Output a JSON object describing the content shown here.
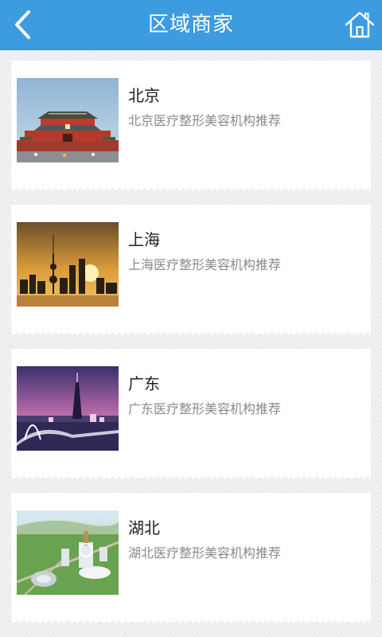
{
  "header": {
    "title": "区域商家",
    "back_icon": "chevron-left-icon",
    "home_icon": "home-icon",
    "bg_color": "#3d9be0"
  },
  "regions": [
    {
      "name": "北京",
      "description": "北京医疗整形美容机构推荐",
      "image": "tiananmen-gate-photo"
    },
    {
      "name": "上海",
      "description": "上海医疗整形美容机构推荐",
      "image": "shanghai-skyline-sunset-photo"
    },
    {
      "name": "广东",
      "description": "广东医疗整形美容机构推荐",
      "image": "guangzhou-canton-tower-night-photo"
    },
    {
      "name": "湖北",
      "description": "湖北医疗整形美容机构推荐",
      "image": "hubei-aerial-city-photo"
    }
  ]
}
